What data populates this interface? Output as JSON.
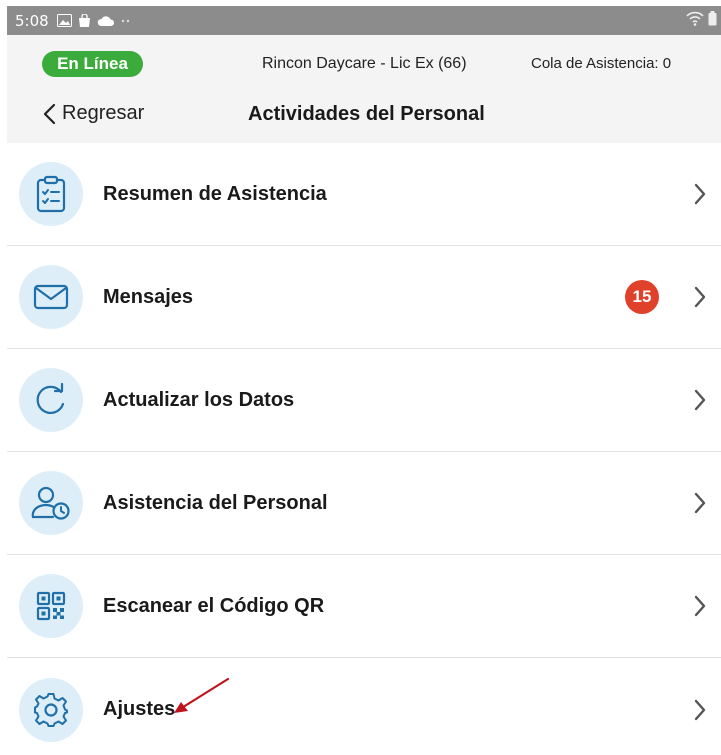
{
  "status_bar": {
    "time": "5:08"
  },
  "header": {
    "online_label": "En Línea",
    "center_name": "Rincon Daycare - Lic Ex (66)",
    "queue_label": "Cola de Asistencia: 0",
    "back_label": "Regresar",
    "page_title": "Actividades del Personal"
  },
  "menu": {
    "items": [
      {
        "label": "Resumen de Asistencia",
        "icon": "clipboard-checklist-icon"
      },
      {
        "label": "Mensajes",
        "icon": "envelope-icon",
        "badge": "15"
      },
      {
        "label": "Actualizar los Datos",
        "icon": "refresh-icon"
      },
      {
        "label": "Asistencia del Personal",
        "icon": "user-clock-icon"
      },
      {
        "label": "Escanear el Código QR",
        "icon": "qr-code-icon"
      },
      {
        "label": "Ajustes",
        "icon": "gear-icon"
      }
    ]
  },
  "colors": {
    "accent": "#1f6fa8",
    "icon_bg": "#deeef9",
    "online": "#3bab3b",
    "badge": "#e0412b",
    "annotation": "#c0141c"
  }
}
